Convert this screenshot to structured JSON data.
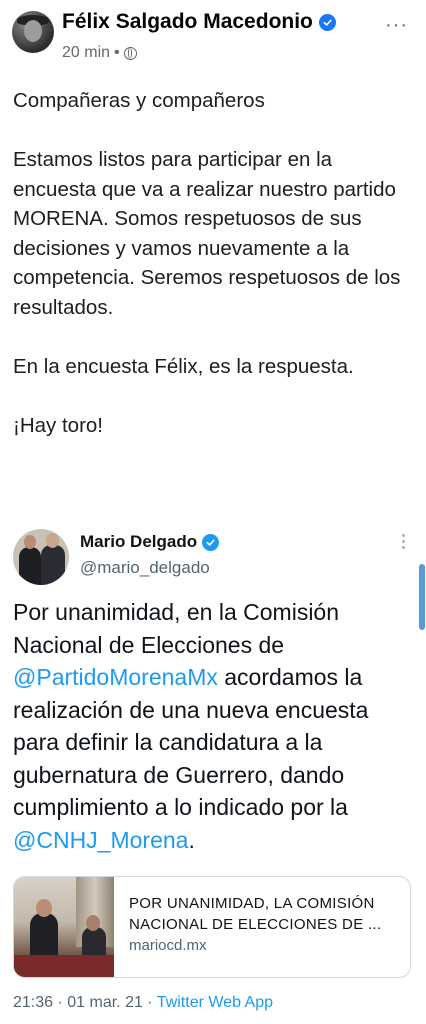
{
  "post": {
    "author": "Félix Salgado Macedonio",
    "time": "20 min",
    "separator": "•",
    "more_label": "···",
    "paragraphs": [
      "Compañeras y compañeros",
      "Estamos listos para participar en la encuesta que va a realizar nuestro partido MORENA. Somos respetuosos de sus decisiones y vamos nuevamente a la competencia. Seremos respetuosos de los resultados.",
      "En la encuesta Félix, es la respuesta.",
      "¡Hay toro!"
    ]
  },
  "tweet": {
    "name": "Mario Delgado",
    "handle": "@mario_delgado",
    "text_1": "Por unanimidad, en la Comisión Nacional de Elecciones de ",
    "mention_1": "@PartidoMorenaMx",
    "text_2": " acordamos la realización de una nueva encuesta para definir la candidatura a la gubernatura de Guerrero, dando cumplimiento a lo indicado por la ",
    "mention_2": "@CNHJ_Morena",
    "text_3": ".",
    "card": {
      "title_line1": "POR UNANIMIDAD, LA COMISIÓN",
      "title_line2": "NACIONAL DE ELECCIONES DE ...",
      "domain": "mariocd.mx"
    },
    "timestamp": "21:36 · 01 mar. 21",
    "footer_sep": " · ",
    "app": "Twitter Web App"
  },
  "colors": {
    "fb_verified": "#1877f2",
    "twitter_blue": "#1d9bf0",
    "muted": "#65676b"
  }
}
